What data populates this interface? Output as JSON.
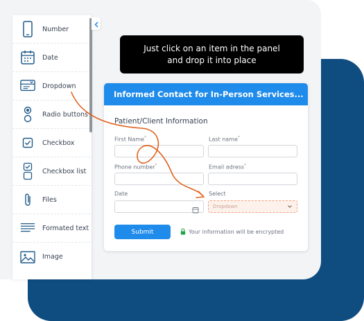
{
  "panel": {
    "items": [
      {
        "label": "Number",
        "icon": "phone-icon"
      },
      {
        "label": "Date",
        "icon": "calendar-icon"
      },
      {
        "label": "Dropdown",
        "icon": "dropdown-icon"
      },
      {
        "label": "Radio buttons",
        "icon": "radio-icon"
      },
      {
        "label": "Checkbox",
        "icon": "checkbox-icon"
      },
      {
        "label": "Checkbox list",
        "icon": "checkbox-list-icon"
      },
      {
        "label": "Files",
        "icon": "paperclip-icon"
      },
      {
        "label": "Formated text",
        "icon": "text-lines-icon"
      },
      {
        "label": "Image",
        "icon": "image-icon"
      }
    ]
  },
  "tooltip": {
    "line1": "Just click on an item in the panel",
    "line2": "and drop it into place"
  },
  "form": {
    "title": "Informed Contact for In-Person Services...",
    "section_title": "Patient/Client Information",
    "fields": {
      "first_name": "First Name",
      "last_name": "Last name",
      "phone": "Phone number",
      "email": "Email adress",
      "date": "Date",
      "select": "Select"
    },
    "required_mark": "*",
    "dropdown_placeholder": "Dropdown",
    "submit_label": "Submit",
    "encrypt_note": "Your information will be encrypted"
  },
  "colors": {
    "accent": "#1f8bea",
    "navy": "#0f4c80",
    "arrow": "#e0621e"
  }
}
